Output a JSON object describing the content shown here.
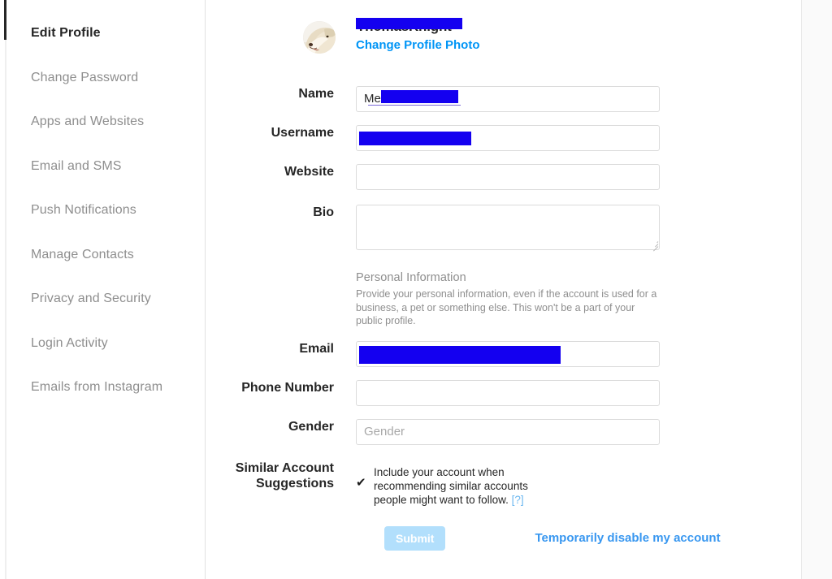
{
  "colors": {
    "accent_link": "#0095f6",
    "disable_link": "#3897f0",
    "submit_disabled_bg": "#b2dffc",
    "redaction": "#1400f0",
    "active_nav_rail": "#262626",
    "muted_text": "#8e8e8e",
    "help_link": "#6bb7f0"
  },
  "sidebar": {
    "items": [
      {
        "label": "Edit Profile",
        "active": true
      },
      {
        "label": "Change Password",
        "active": false
      },
      {
        "label": "Apps and Websites",
        "active": false
      },
      {
        "label": "Email and SMS",
        "active": false
      },
      {
        "label": "Push Notifications",
        "active": false
      },
      {
        "label": "Manage Contacts",
        "active": false
      },
      {
        "label": "Privacy and Security",
        "active": false
      },
      {
        "label": "Login Activity",
        "active": false
      },
      {
        "label": "Emails from Instagram",
        "active": false
      }
    ]
  },
  "header": {
    "avatar_icon": "dog-photo-avatar",
    "username_text": "ThomasKnight",
    "username_redacted": true,
    "change_photo_label": "Change Profile Photo"
  },
  "fields": {
    "name": {
      "label": "Name",
      "value": "Me",
      "value_redacted": true,
      "placeholder": "",
      "has_spellcheck_underline": true
    },
    "username": {
      "label": "Username",
      "value": "",
      "value_redacted": true,
      "placeholder": ""
    },
    "website": {
      "label": "Website",
      "value": "",
      "placeholder": ""
    },
    "bio": {
      "label": "Bio",
      "value": "",
      "placeholder": ""
    },
    "email": {
      "label": "Email",
      "value": "",
      "value_redacted": true,
      "placeholder": ""
    },
    "phone": {
      "label": "Phone Number",
      "value": "",
      "placeholder": ""
    },
    "gender": {
      "label": "Gender",
      "value": "",
      "placeholder": "Gender"
    }
  },
  "personal_information": {
    "title": "Personal Information",
    "body": "Provide your personal information, even if the account is used for a business, a pet or something else. This won't be a part of your public profile."
  },
  "similar_accounts": {
    "label_line_1": "Similar Account",
    "label_line_2": "Suggestions",
    "checked": true,
    "checkmark_glyph": "✔",
    "description": "Include your account when recommending similar accounts people might want to follow.",
    "help_label": "[?]"
  },
  "actions": {
    "submit_label": "Submit",
    "submit_disabled": true,
    "disable_account_label": "Temporarily disable my account"
  }
}
